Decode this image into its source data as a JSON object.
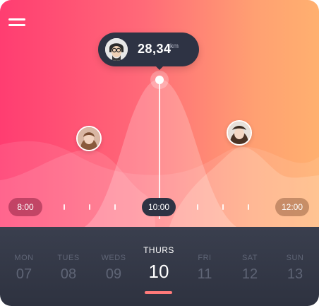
{
  "colors": {
    "gradient_start": "#ff3d71",
    "gradient_end": "#ffb06f",
    "bar_bg": "#2e3344",
    "accent_underline": "#ff7a7a"
  },
  "header": {
    "menu_icon": "hamburger-menu-icon"
  },
  "highlight": {
    "value": "28,34",
    "unit": "km"
  },
  "timeline": {
    "start_label": "8:00",
    "mid_label": "10:00",
    "end_label": "12:00"
  },
  "days": [
    {
      "name": "MON",
      "date": "07",
      "active": false
    },
    {
      "name": "TUES",
      "date": "08",
      "active": false
    },
    {
      "name": "WEDS",
      "date": "09",
      "active": false
    },
    {
      "name": "THURS",
      "date": "10",
      "active": true
    },
    {
      "name": "FRI",
      "date": "11",
      "active": false
    },
    {
      "name": "SAT",
      "date": "12",
      "active": false
    },
    {
      "name": "SUN",
      "date": "13",
      "active": false
    }
  ]
}
